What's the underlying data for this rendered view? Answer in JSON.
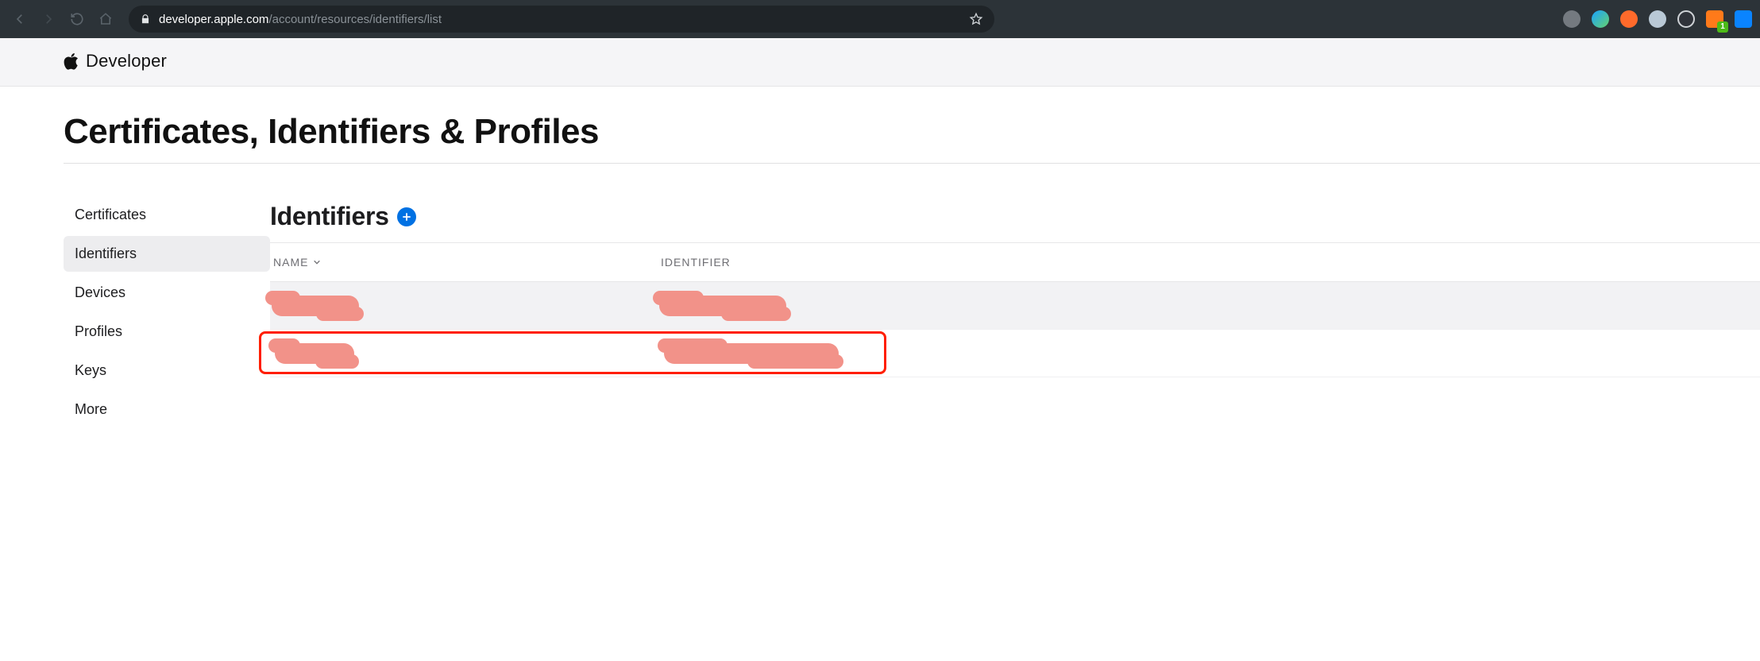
{
  "browser": {
    "url_host": "developer.apple.com",
    "url_path": "/account/resources/identifiers/list",
    "ext_badge": "1"
  },
  "header": {
    "brand": "Developer"
  },
  "page": {
    "title": "Certificates, Identifiers & Profiles"
  },
  "sidebar": {
    "items": [
      {
        "label": "Certificates",
        "active": false
      },
      {
        "label": "Identifiers",
        "active": true
      },
      {
        "label": "Devices",
        "active": false
      },
      {
        "label": "Profiles",
        "active": false
      },
      {
        "label": "Keys",
        "active": false
      },
      {
        "label": "More",
        "active": false
      }
    ]
  },
  "panel": {
    "title": "Identifiers",
    "columns": {
      "name": "NAME",
      "identifier": "IDENTIFIER"
    }
  }
}
